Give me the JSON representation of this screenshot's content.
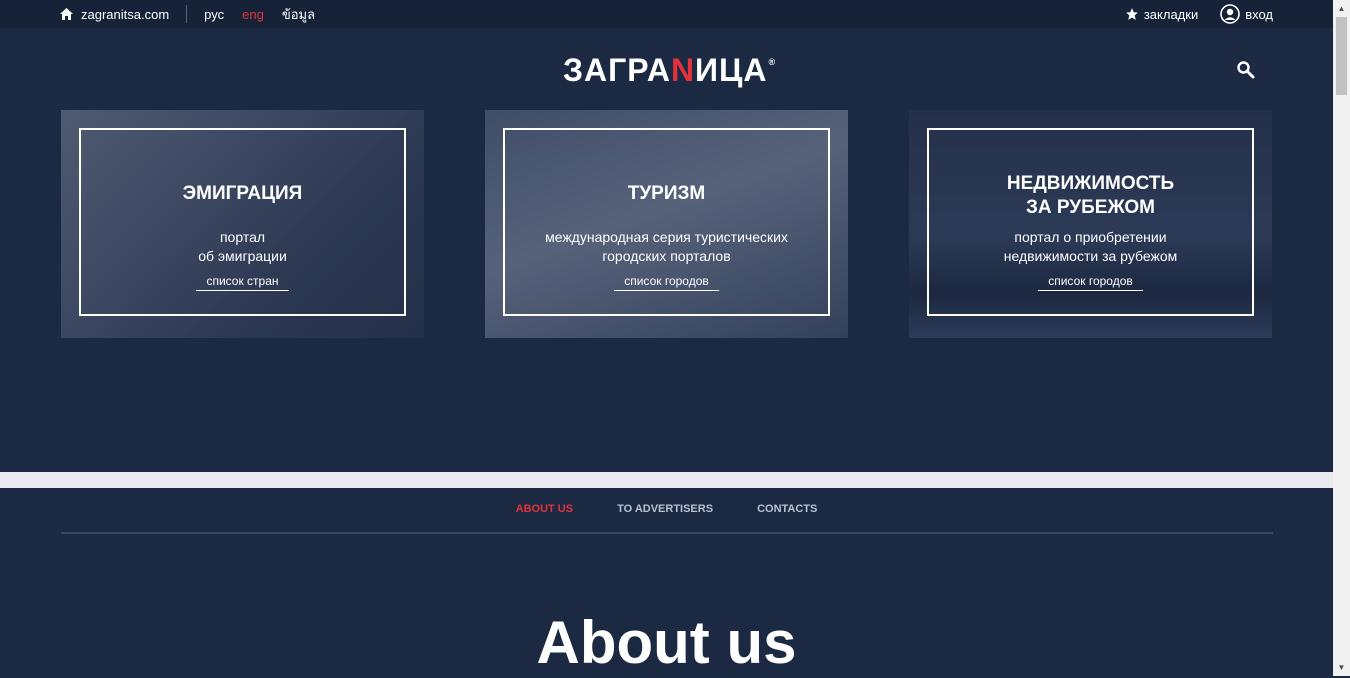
{
  "topbar": {
    "site": "zagranitsa.com",
    "languages": [
      "рус",
      "eng",
      "ข้อมูล"
    ],
    "bookmarks": "закладки",
    "login": "вход"
  },
  "logo": {
    "pre": "ЗАГРА",
    "n": "N",
    "post": "ИЦА",
    "reg": "®"
  },
  "cards": [
    {
      "title": "ЭМИГРАЦИЯ",
      "title2": "",
      "desc1": "портал",
      "desc2": "об эмиграции",
      "link": "список стран"
    },
    {
      "title": "ТУРИЗМ",
      "title2": "",
      "desc1": "международная серия туристических",
      "desc2": "городских порталов",
      "link": "список городов"
    },
    {
      "title": "НЕДВИЖИМОСТЬ",
      "title2": "ЗА РУБЕЖОМ",
      "desc1": "портал о приобретении",
      "desc2": "недвижимости за рубежом",
      "link": "список городов"
    }
  ],
  "footer_nav": [
    "ABOUT US",
    "TO ADVERTISERS",
    "CONTACTS"
  ],
  "about_heading": "About us",
  "colors": {
    "accent": "#e2323b",
    "background": "#1b2943"
  }
}
